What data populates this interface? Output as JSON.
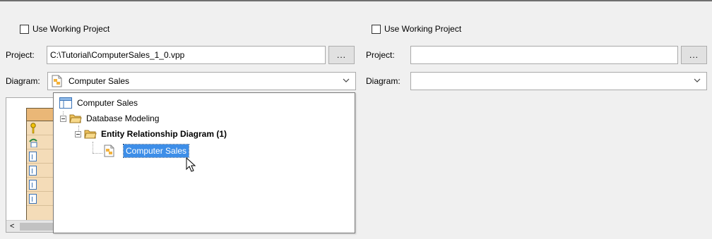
{
  "left": {
    "use_working_project": "Use Working Project",
    "project_label": "Project:",
    "project_value": "C:\\Tutorial\\ComputerSales_1_0.vpp",
    "browse_label": "...",
    "diagram_label": "Diagram:",
    "diagram_value": "Computer Sales"
  },
  "right": {
    "use_working_project": "Use Working Project",
    "project_label": "Project:",
    "project_value": "",
    "browse_label": "...",
    "diagram_label": "Diagram:",
    "diagram_value": ""
  },
  "tree": {
    "root": "Computer Sales",
    "folder1": "Database Modeling",
    "folder2": "Entity Relationship Diagram (1)",
    "leaf": "Computer Sales"
  },
  "colors": {
    "selection": "#3d8ee8",
    "entity_fill": "#f4dcb8",
    "entity_header": "#eab777",
    "folder": "#f1c35c"
  }
}
